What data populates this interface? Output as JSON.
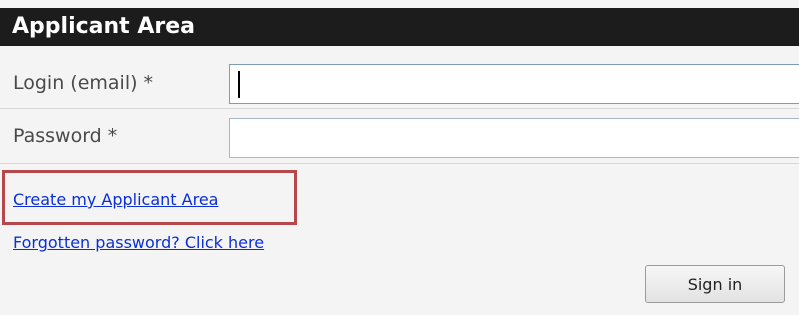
{
  "header": {
    "title": "Applicant Area"
  },
  "form": {
    "login_label": "Login (email) *",
    "login_value": "",
    "password_label": "Password *",
    "password_value": ""
  },
  "links": {
    "create_area": "Create my Applicant Area",
    "forgot_password": "Forgotten password? Click here"
  },
  "actions": {
    "sign_in_label": "Sign in"
  },
  "colors": {
    "header_bg": "#1c1c1c",
    "link": "#0a2fd8",
    "highlight": "#b5484a"
  }
}
